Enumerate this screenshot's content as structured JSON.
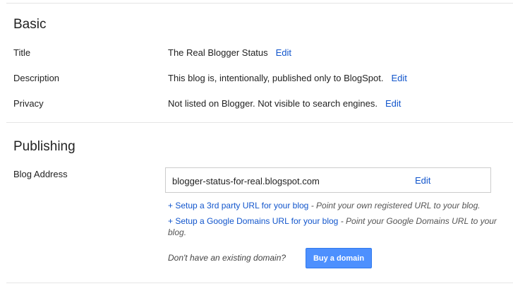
{
  "basic": {
    "title": "Basic",
    "rows": [
      {
        "label": "Title",
        "value": "The Real Blogger Status",
        "edit": "Edit"
      },
      {
        "label": "Description",
        "value": "This blog is, intentionally, published only to BlogSpot.",
        "edit": "Edit"
      },
      {
        "label": "Privacy",
        "value": "Not listed on Blogger. Not visible to search engines.",
        "edit": "Edit"
      }
    ]
  },
  "publishing": {
    "title": "Publishing",
    "blog_address_label": "Blog Address",
    "address": "blogger-status-for-real.blogspot.com",
    "address_edit": "Edit",
    "third_party_link": "+ Setup a 3rd party URL for your blog",
    "third_party_desc": "- Point your own registered URL to your blog.",
    "google_domains_link": "+ Setup a Google Domains URL for your blog",
    "google_domains_desc": "- Point your Google Domains URL to your blog.",
    "no_domain_text": "Don't have an existing domain?",
    "buy_domain_button": "Buy a domain"
  }
}
